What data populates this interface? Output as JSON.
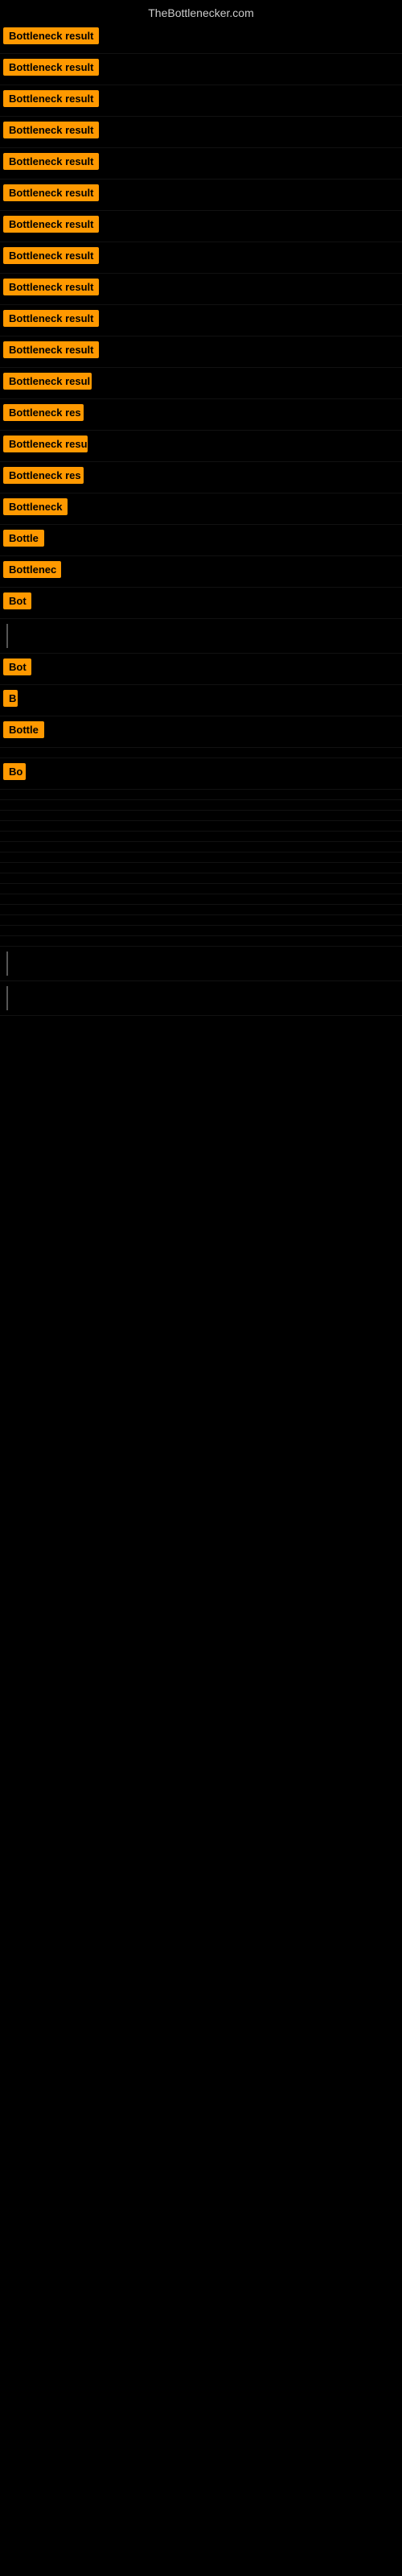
{
  "site": {
    "title": "TheBottlenecker.com"
  },
  "rows": [
    {
      "label": "Bottleneck result",
      "width": 120
    },
    {
      "label": "Bottleneck result",
      "width": 120
    },
    {
      "label": "Bottleneck result",
      "width": 120
    },
    {
      "label": "Bottleneck result",
      "width": 120
    },
    {
      "label": "Bottleneck result",
      "width": 120
    },
    {
      "label": "Bottleneck result",
      "width": 120
    },
    {
      "label": "Bottleneck result",
      "width": 120
    },
    {
      "label": "Bottleneck result",
      "width": 120
    },
    {
      "label": "Bottleneck result",
      "width": 120
    },
    {
      "label": "Bottleneck result",
      "width": 120
    },
    {
      "label": "Bottleneck result",
      "width": 120
    },
    {
      "label": "Bottleneck resul",
      "width": 110
    },
    {
      "label": "Bottleneck res",
      "width": 100
    },
    {
      "label": "Bottleneck resu",
      "width": 105
    },
    {
      "label": "Bottleneck res",
      "width": 100
    },
    {
      "label": "Bottleneck",
      "width": 80
    },
    {
      "label": "Bottle",
      "width": 55
    },
    {
      "label": "Bottlenec",
      "width": 72
    },
    {
      "label": "Bot",
      "width": 35
    },
    {
      "label": "",
      "width": 0,
      "bar": true
    },
    {
      "label": "Bot",
      "width": 35
    },
    {
      "label": "B",
      "width": 18
    },
    {
      "label": "Bottle",
      "width": 55
    },
    {
      "label": "",
      "width": 0
    },
    {
      "label": "Bo",
      "width": 28
    },
    {
      "label": "",
      "width": 0
    },
    {
      "label": "",
      "width": 0
    },
    {
      "label": "",
      "width": 0
    },
    {
      "label": "",
      "width": 0
    },
    {
      "label": "",
      "width": 0
    },
    {
      "label": "",
      "width": 0
    },
    {
      "label": "",
      "width": 0
    },
    {
      "label": "",
      "width": 0
    },
    {
      "label": "",
      "width": 0
    },
    {
      "label": "",
      "width": 0
    },
    {
      "label": "",
      "width": 0
    },
    {
      "label": "",
      "width": 0
    },
    {
      "label": "",
      "width": 0
    },
    {
      "label": "",
      "width": 0
    },
    {
      "label": "",
      "width": 0
    },
    {
      "label": "",
      "width": 0,
      "bar": true
    },
    {
      "label": "",
      "width": 0,
      "bar": true
    }
  ]
}
